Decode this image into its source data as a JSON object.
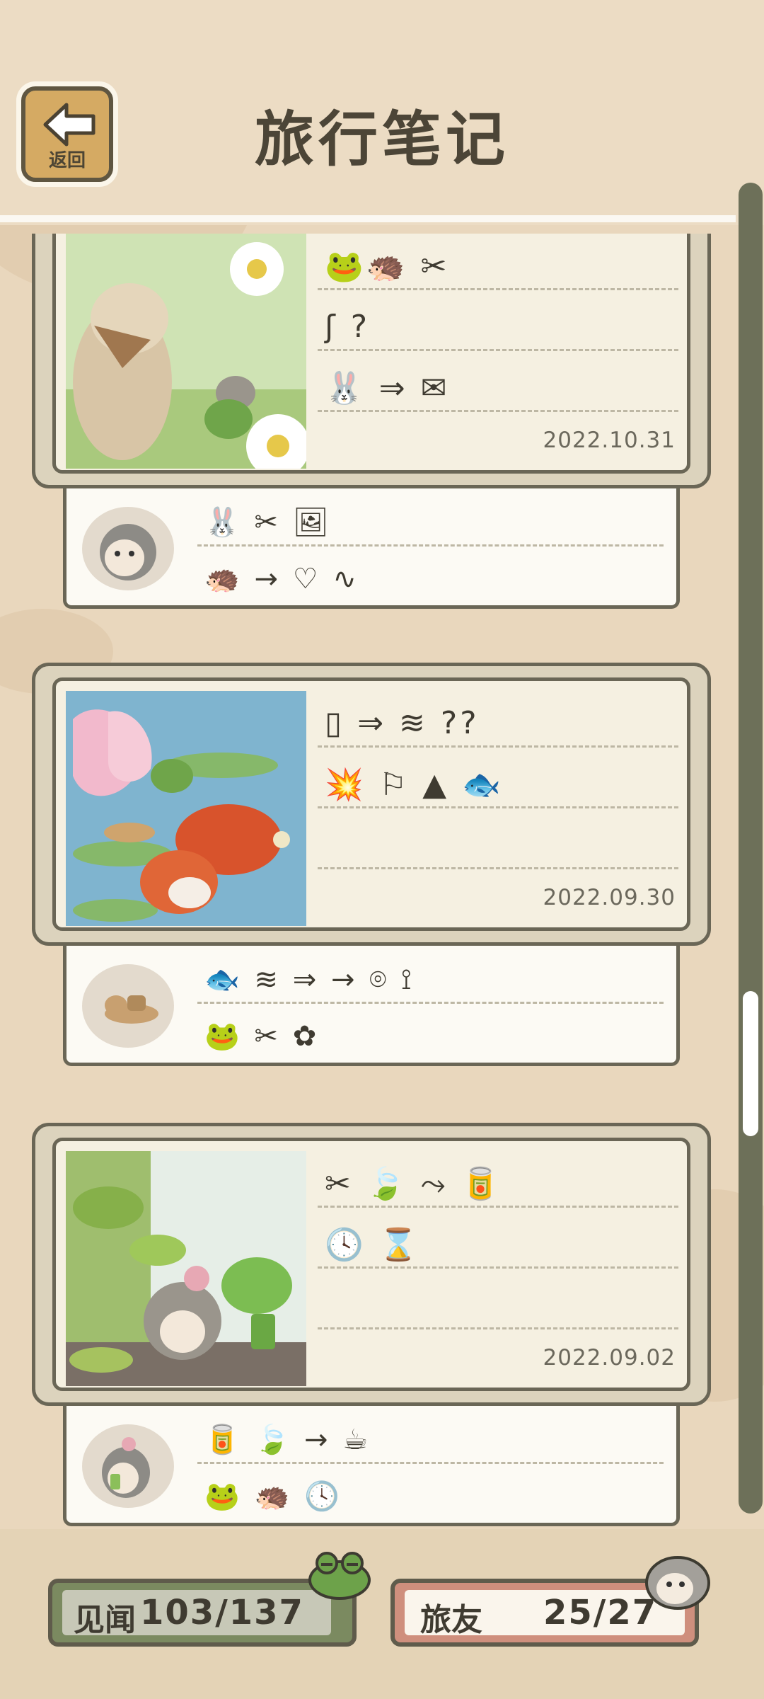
{
  "header": {
    "back_label": "返回",
    "title": "旅行笔记"
  },
  "entries": [
    {
      "photo": "rabbit-hedgehog-frog-daisies",
      "lines": [
        "🐸🦔 ✂",
        "ʃ ?",
        "🐰 ⇒ ✉"
      ],
      "date": "2022.10.31",
      "avatar": "hedgehog",
      "sub_lines": [
        "🐰 ✂ 🖼",
        "🦔 → ♡ ∿"
      ]
    },
    {
      "photo": "lotus-koi-frog-lizard",
      "lines": [
        "▯ ⇒ ≋ ??",
        "💥 ⚐ ▲ 🐟",
        ""
      ],
      "date": "2022.09.30",
      "avatar": "lizard",
      "sub_lines": [
        "🐟 ≋ ⇒ → ⌾ ⟟",
        "🐸 ✂ ✿"
      ]
    },
    {
      "photo": "frog-hedgehog-tea-leaves",
      "lines": [
        "✂ 🍃 ⤳ 🥫",
        "🕓 ⌛",
        ""
      ],
      "date": "2022.09.02",
      "avatar": "hedgehog-flower",
      "sub_lines": [
        "🥫 🍃 → ☕",
        "🐸 🦔 🕓"
      ]
    }
  ],
  "footer": {
    "discoveries_label": "见闻",
    "discoveries_value": "103/137",
    "friends_label": "旅友",
    "friends_value": "25/27"
  },
  "scroll": {
    "position": 0.62
  },
  "colors": {
    "background": "#e9d7bd",
    "card_border": "#6a6656",
    "paper": "#f5f0e1",
    "discoveries_bar": "#7b8a60",
    "friends_bar": "#cf8f7d"
  }
}
